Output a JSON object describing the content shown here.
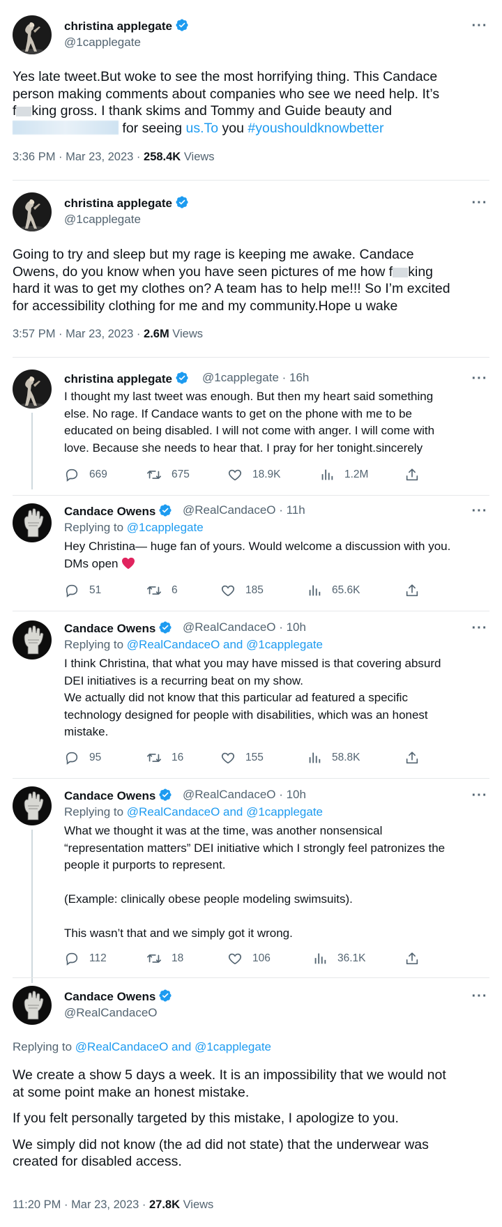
{
  "tweets": [
    {
      "author": "christina applegate",
      "handle": "@1capplegate",
      "text_line1": "Yes late tweet.But woke to see the most horrifying thing. This Candace",
      "text_line2": "person making comments about companies who see we need help. It’s",
      "text_line3_a": "f",
      "text_line3_b": "king gross. I thank skims and Tommy and Guide beauty and",
      "text_line4": "for seeing",
      "link": "us.To",
      "text_line4_b": "you",
      "hashtag": "#youshouldknowbetter",
      "time": "3:36 PM · Mar 23, 2023 ·",
      "views_count": "258.4K",
      "views_label": "Views"
    },
    {
      "author": "christina applegate",
      "handle": "@1capplegate",
      "line1": "Going to try and sleep but my rage is keeping me awake. Candace",
      "line2_a": "Owens, do you know when you have seen pictures of me how f",
      "line2_b": "king",
      "line3": "hard it was to get my clothes on? A team has to help me!!! So I’m excited",
      "line4": "for accessibility clothing for me and my community.Hope u wake",
      "time": "3:57 PM · Mar 23, 2023 ·",
      "views_count": "2.6M",
      "views_label": "Views"
    },
    {
      "author": "christina applegate",
      "handle": "@1capplegate · 16h",
      "line1": "I thought my last tweet was enough. But then my heart said something",
      "line2": "else. No rage. If Candace wants to get on the phone with me to be",
      "line3": "educated on being disabled. I will not come with anger. I will come with",
      "line4": "love. Because she needs to hear that. I pray for her tonight.sincerely",
      "replies": "669",
      "retweets": "675",
      "likes": "18.9K",
      "views": "1.2M"
    },
    {
      "author": "Candace Owens",
      "handle": "@RealCandaceO · 11h",
      "replying_prefix": "Replying to",
      "replying_to": "@1capplegate",
      "line1": "Hey Christina— huge fan of yours. Would welcome a discussion with you.",
      "line2": "DMs open",
      "replies": "51",
      "retweets": "6",
      "likes": "185",
      "views": "65.6K"
    },
    {
      "author": "Candace Owens",
      "handle": "@RealCandaceO · 10h",
      "replying_prefix": "Replying to",
      "replying_to": "@RealCandaceO and @1capplegate",
      "line1": "I think Christina, that what you may have missed is that covering absurd",
      "line2": "DEI initiatives is a recurring beat on my show.",
      "line3": "We actually did not know that this particular ad featured a specific",
      "line4": "technology designed for people with disabilities, which was an honest",
      "line5": "mistake.",
      "replies": "95",
      "retweets": "16",
      "likes": "155",
      "views": "58.8K"
    },
    {
      "author": "Candace Owens",
      "handle": "@RealCandaceO · 10h",
      "replying_prefix": "Replying to",
      "replying_to": "@RealCandaceO and @1capplegate",
      "line1": "What we thought it was at the time, was another nonsensical",
      "line2": "“representation matters” DEI initiative which I strongly feel patronizes the",
      "line3": "people it purports to represent.",
      "line4": "(Example: clinically obese people modeling swimsuits).",
      "line5": "This wasn’t that and we simply got it wrong.",
      "replies": "112",
      "retweets": "18",
      "likes": "106",
      "views": "36.1K"
    },
    {
      "author": "Candace Owens",
      "handle": "@RealCandaceO",
      "replying_prefix": "Replying to",
      "replying_to": "@RealCandaceO and @1capplegate",
      "line1": "We create a show 5 days a week. It is an impossibility that we would not",
      "line2": "at some point make an honest mistake.",
      "line3": "If you felt personally targeted by this mistake, I apologize to you.",
      "line4": "We simply did not know (the ad did not state) that the underwear was",
      "line5": "created for disabled access.",
      "time": "11:20 PM · Mar 23, 2023 ·",
      "views_count": "27.8K",
      "views_label": "Views"
    }
  ],
  "icons": {
    "verified": "verified-badge-icon",
    "more": "more-dots-icon",
    "reply": "reply-icon",
    "retweet": "retweet-icon",
    "like": "heart-icon",
    "views": "views-chart-icon",
    "share": "share-icon",
    "heart_emoji": "red-heart-emoji"
  },
  "colors": {
    "link": "#1d9bf0",
    "secondary": "#536471",
    "verified": "#1d9bf0",
    "emoji_heart": "#e0245e"
  }
}
